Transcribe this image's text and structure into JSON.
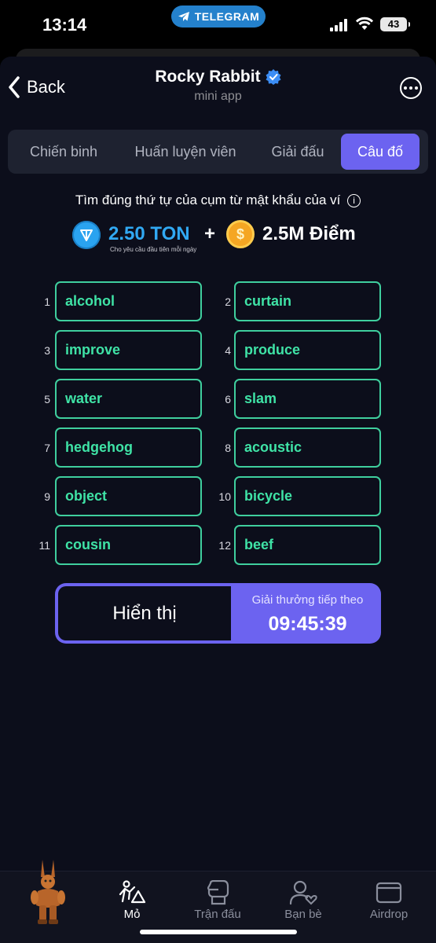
{
  "status_bar": {
    "time": "13:14",
    "telegram_label": "TELEGRAM",
    "battery": "43"
  },
  "header": {
    "back_label": "Back",
    "title": "Rocky Rabbit",
    "subtitle": "mini app",
    "more_icon": "ellipsis-circle-icon"
  },
  "tabs": [
    {
      "label": "Chiến binh",
      "active": false
    },
    {
      "label": "Huấn luyện viên",
      "active": false
    },
    {
      "label": "Giải đấu",
      "active": false
    },
    {
      "label": "Câu đố",
      "active": true
    }
  ],
  "puzzle": {
    "instruction": "Tìm đúng thứ tự của cụm từ mật khẩu của ví",
    "reward_ton": "2.50 TON",
    "reward_ton_note": "Cho yêu cầu đầu tiên mỗi ngày",
    "plus": "+",
    "reward_points": "2.5M Điểm",
    "words": [
      {
        "num": "1",
        "word": "alcohol"
      },
      {
        "num": "2",
        "word": "curtain"
      },
      {
        "num": "3",
        "word": "improve"
      },
      {
        "num": "4",
        "word": "produce"
      },
      {
        "num": "5",
        "word": "water"
      },
      {
        "num": "6",
        "word": "slam"
      },
      {
        "num": "7",
        "word": "hedgehog"
      },
      {
        "num": "8",
        "word": "acoustic"
      },
      {
        "num": "9",
        "word": "object"
      },
      {
        "num": "10",
        "word": "bicycle"
      },
      {
        "num": "11",
        "word": "cousin"
      },
      {
        "num": "12",
        "word": "beef"
      }
    ],
    "reveal_label": "Hiển thị",
    "next_reward_label": "Giải thưởng tiếp theo",
    "countdown": "09:45:39"
  },
  "bottom_nav": [
    {
      "label": "Mỏ",
      "icon": "mining-icon",
      "active": true
    },
    {
      "label": "Trận đấu",
      "icon": "boxing-glove-icon",
      "active": false
    },
    {
      "label": "Bạn bè",
      "icon": "friends-icon",
      "active": false
    },
    {
      "label": "Airdrop",
      "icon": "wallet-icon",
      "active": false
    }
  ],
  "colors": {
    "accent": "#6c63f0",
    "word_border": "#3fcf9e",
    "ton_blue": "#31a9f3",
    "background": "#0c0e1b"
  }
}
